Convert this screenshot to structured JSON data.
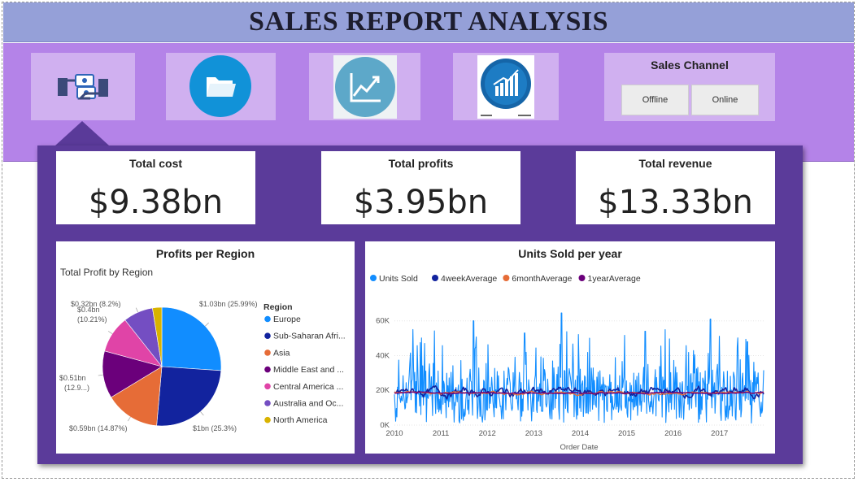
{
  "header": {
    "title": "SALES REPORT ANALYSIS"
  },
  "nav": {
    "icons": [
      "money-exchange-icon",
      "folder-icon",
      "trend-up-icon",
      "bar-chart-icon"
    ]
  },
  "sales_channel": {
    "title": "Sales Channel",
    "options": [
      "Offline",
      "Online"
    ]
  },
  "kpis": [
    {
      "label": "Total cost",
      "value": "$9.38bn"
    },
    {
      "label": "Total profits",
      "value": "$3.95bn"
    },
    {
      "label": "Total revenue",
      "value": "$13.33bn"
    }
  ],
  "pie_card": {
    "title": "Profits per Region",
    "subtitle": "Total Profit by Region",
    "legend_title": "Region"
  },
  "line_card": {
    "title": "Units Sold per year"
  },
  "chart_data": [
    {
      "type": "pie",
      "title": "Profits per Region",
      "subtitle": "Total Profit by Region",
      "legend_title": "Region",
      "legend_position": "right",
      "categories": [
        "Europe",
        "Sub-Saharan Afri...",
        "Asia",
        "Middle East and ...",
        "Central America ...",
        "Australia and Oc...",
        "North America"
      ],
      "values": [
        1.03,
        1.0,
        0.59,
        0.51,
        0.4,
        0.32,
        0.1
      ],
      "percents": [
        25.99,
        25.3,
        14.87,
        12.9,
        10.21,
        8.2,
        2.5
      ],
      "data_labels": [
        "$1.03bn (25.99%)",
        "$1bn (25.3%)",
        "$0.59bn (14.87%)",
        "$0.51bn (12.9...)",
        "$0.4bn (10.21%)",
        "$0.32bn (8.2%)",
        ""
      ],
      "colors": [
        "#118dff",
        "#12239e",
        "#e66c37",
        "#6b007b",
        "#e044a7",
        "#744ec2",
        "#d9b300"
      ]
    },
    {
      "type": "line",
      "title": "Units Sold per year",
      "xlabel": "Order Date",
      "ylabel": "",
      "legend_position": "top-left",
      "x_ticks": [
        "2010",
        "2011",
        "2012",
        "2013",
        "2014",
        "2015",
        "2016",
        "2017"
      ],
      "y_ticks": [
        "0K",
        "20K",
        "40K",
        "60K"
      ],
      "ylim": [
        0,
        65000
      ],
      "xlim": [
        2010.0,
        2017.95
      ],
      "grid": true,
      "series": [
        {
          "name": "Units Sold",
          "color": "#118dff",
          "mean": 18000,
          "spread": 15000,
          "peaks": [
            [
              2010.4,
              55000
            ],
            [
              2011.7,
              60000
            ],
            [
              2012.8,
              53000
            ],
            [
              2013.6,
              66000
            ],
            [
              2014.2,
              50000
            ],
            [
              2015.4,
              54000
            ],
            [
              2016.8,
              61000
            ],
            [
              2017.6,
              48000
            ]
          ]
        },
        {
          "name": "4weekAverage",
          "color": "#12239e",
          "mean": 19000,
          "spread": 4000
        },
        {
          "name": "6monthAverage",
          "color": "#e66c37",
          "mean": 18500,
          "spread": 1200
        },
        {
          "name": "1yearAverage",
          "color": "#6b007b",
          "mean": 18500,
          "spread": 500
        }
      ]
    }
  ]
}
